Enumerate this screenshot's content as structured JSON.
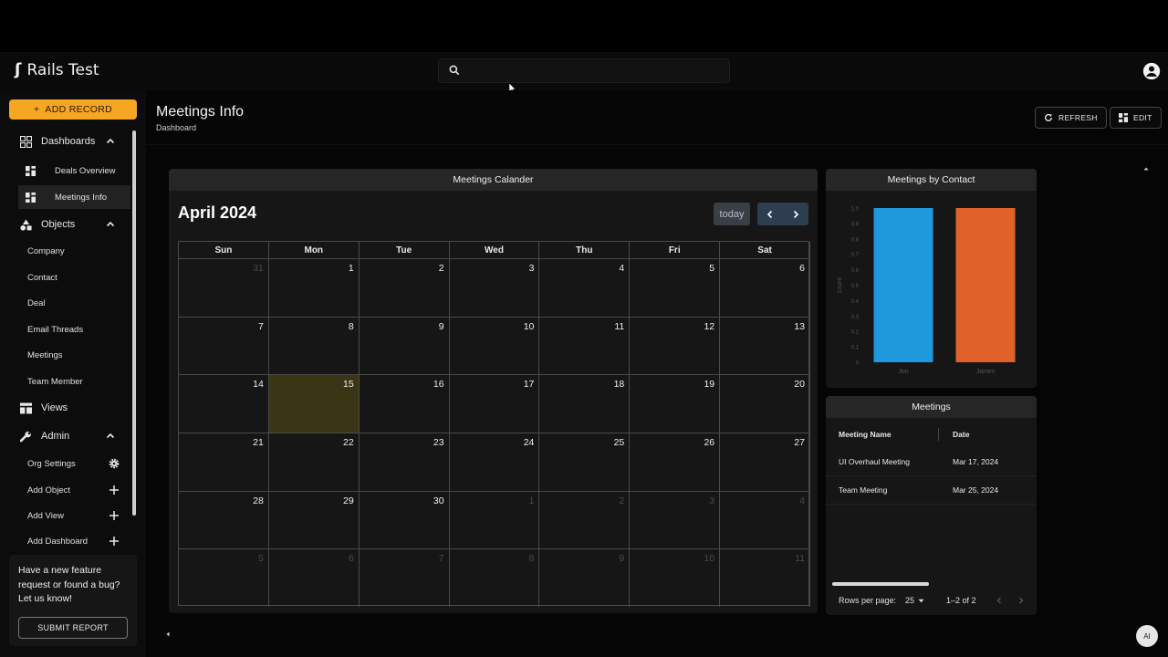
{
  "app": {
    "name": "Rails Test"
  },
  "search": {
    "placeholder": ""
  },
  "sidebar": {
    "add_record_label": "ADD RECORD",
    "dashboards": {
      "label": "Dashboards",
      "items": [
        "Deals Overview",
        "Meetings Info"
      ]
    },
    "objects": {
      "label": "Objects",
      "items": [
        "Company",
        "Contact",
        "Deal",
        "Email Threads",
        "Meetings",
        "Team Member"
      ]
    },
    "views_label": "Views",
    "admin": {
      "label": "Admin",
      "items": [
        "Org Settings",
        "Add Object",
        "Add View",
        "Add Dashboard"
      ]
    },
    "feedback": {
      "text": "Have a new feature request or found a bug? Let us know!",
      "button": "SUBMIT REPORT"
    }
  },
  "page": {
    "title": "Meetings Info",
    "subtitle": "Dashboard",
    "refresh_label": "REFRESH",
    "edit_label": "EDIT"
  },
  "calendar": {
    "card_title": "Meetings Calander",
    "month_title": "April 2024",
    "today_label": "today",
    "weekdays": [
      "Sun",
      "Mon",
      "Tue",
      "Wed",
      "Thu",
      "Fri",
      "Sat"
    ],
    "weeks": [
      [
        "31",
        "1",
        "2",
        "3",
        "4",
        "5",
        "6"
      ],
      [
        "7",
        "8",
        "9",
        "10",
        "11",
        "12",
        "13"
      ],
      [
        "14",
        "15",
        "16",
        "17",
        "18",
        "19",
        "20"
      ],
      [
        "21",
        "22",
        "23",
        "24",
        "25",
        "26",
        "27"
      ],
      [
        "28",
        "29",
        "30",
        "1",
        "2",
        "3",
        "4"
      ],
      [
        "5",
        "6",
        "7",
        "8",
        "9",
        "10",
        "11"
      ]
    ],
    "today_day": "15"
  },
  "contact_chart": {
    "card_title": "Meetings by Contact"
  },
  "chart_data": {
    "type": "bar",
    "title": "Meetings by Contact",
    "categories": [
      "Jon",
      "James"
    ],
    "values": [
      1,
      1
    ],
    "colors": [
      "#1f98dc",
      "#e0622a"
    ],
    "xlabel": "",
    "ylabel": "count",
    "ylim": [
      0,
      1
    ],
    "yticks": [
      "0",
      "0.1",
      "0.2",
      "0.3",
      "0.4",
      "0.5",
      "0.6",
      "0.7",
      "0.8",
      "0.9",
      "1.0"
    ],
    "grid": false
  },
  "meetings_table": {
    "card_title": "Meetings",
    "columns": [
      "Meeting Name",
      "Date"
    ],
    "rows": [
      [
        "UI Overhaul Meeting",
        "Mar 17, 2024"
      ],
      [
        "Team Meeting",
        "Mar 25, 2024"
      ]
    ],
    "rows_per_page_label": "Rows per page:",
    "rows_per_page": "25",
    "range": "1–2 of 2"
  },
  "ai_badge": "AI",
  "colors": {
    "accent": "#f5a623",
    "today_bg": "#3a3514"
  }
}
